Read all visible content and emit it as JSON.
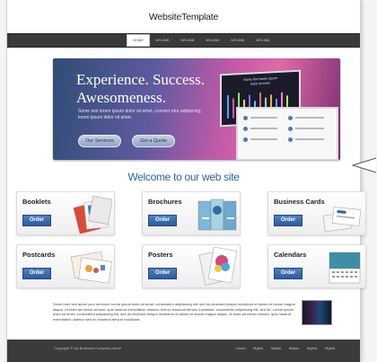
{
  "site": {
    "title": "WebsiteTemplate"
  },
  "nav": {
    "items": [
      {
        "label": "home",
        "active": true
      },
      {
        "label": "mylink",
        "active": false
      },
      {
        "label": "mylink",
        "active": false
      },
      {
        "label": "mylink",
        "active": false
      },
      {
        "label": "mylink",
        "active": false
      },
      {
        "label": "mylink",
        "active": false
      }
    ]
  },
  "hero": {
    "title_line1": "Experience. Success.",
    "title_line2": "Awesomeness.",
    "subtitle": "Some text lorem ipsum dolor sit amet, consect etur adipiscing, lorem ipsum dolor sit amet.",
    "btn_services": "Our Services",
    "btn_quote": "Get a Quote",
    "device_title": "Some Text lorem ipsum dolor sit amet"
  },
  "welcome": {
    "heading": "Welcome to our web site"
  },
  "products": [
    {
      "title": "Booklets",
      "order": "Order"
    },
    {
      "title": "Brochures",
      "order": "Order"
    },
    {
      "title": "Business Cards",
      "order": "Order"
    },
    {
      "title": "Postcards",
      "order": "Order"
    },
    {
      "title": "Posters",
      "order": "Order"
    },
    {
      "title": "Calendars",
      "order": "Order"
    }
  ],
  "body_text": {
    "paragraph": "Some intro text about your services Lorem ipsum dolor sit amet, consectetur adipisicing elit, sed do eiusmod tempor incididunt ut labore et dolore magna aliqua. Ut enim ad minim veniam, quis nostrud exercitation ullamco sed do eiusmod tempor incididunt. consectetur adipisicing elit, sed do. Lorem ipsum dolor sit amet, consectetur adipisicing elit, sed do eiusmod tempor incididunt ut labore et dolore magna aliqua. Ut enim ad minim veniam, quis nostrud exercitation ullamco sed do eiusmod tempor incididunt."
  },
  "footer": {
    "copyright": "Copyright © My Business Company Name",
    "links": [
      "Home",
      "Mylink",
      "Mylink",
      "Mylink",
      "Mylink",
      "Mylink"
    ]
  },
  "colors": {
    "accent_blue": "#2e63a6",
    "nav_bg": "#3a3a3a",
    "footer_bg": "#3b3b3b",
    "order_btn": "#2d5c9c"
  }
}
